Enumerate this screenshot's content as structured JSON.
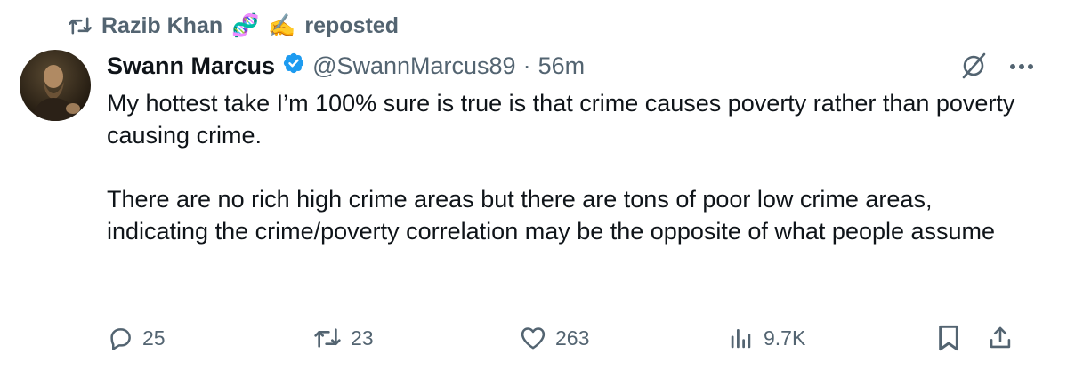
{
  "repost": {
    "icon": "repost-icon",
    "user": "Razib Khan",
    "emoji_1": "🧬",
    "emoji_2": "✍️",
    "label": "reposted"
  },
  "tweet": {
    "author_name": "Swann Marcus",
    "verified": true,
    "handle": "@SwannMarcus89",
    "separator": "·",
    "time": "56m",
    "paragraphs": [
      "My hottest take I’m 100% sure is true is that crime causes poverty rather than poverty causing crime.",
      "There are no rich high crime areas but there are tons of poor low crime areas, indicating the crime/poverty correlation may be the opposite of what people assume"
    ]
  },
  "actions": {
    "replies": "25",
    "reposts": "23",
    "likes": "263",
    "views": "9.7K"
  },
  "colors": {
    "text_primary": "#0f1419",
    "text_secondary": "#536471",
    "verified_blue": "#1d9bf0"
  }
}
